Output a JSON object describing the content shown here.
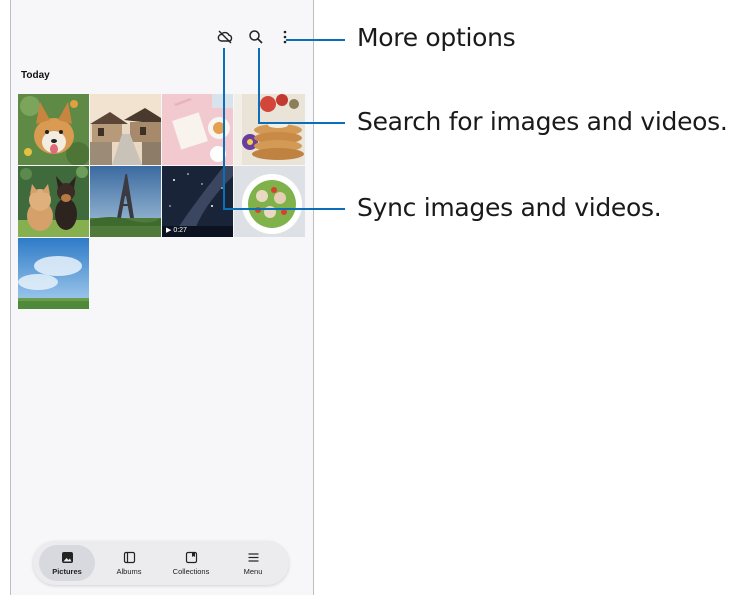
{
  "gallery": {
    "section_title": "Today",
    "video_duration": "▶ 0:27"
  },
  "toolbar": {
    "sync_icon": "cloud-off-icon",
    "search_icon": "search-icon",
    "more_icon": "more-vertical-icon"
  },
  "navbar": {
    "items": [
      {
        "label": "Pictures",
        "icon": "image-icon",
        "active": true
      },
      {
        "label": "Albums",
        "icon": "album-icon",
        "active": false
      },
      {
        "label": "Collections",
        "icon": "collections-icon",
        "active": false
      },
      {
        "label": "Menu",
        "icon": "menu-icon",
        "active": false
      }
    ]
  },
  "callouts": {
    "more_options": "More options",
    "search": "Search for images and videos.",
    "sync": "Sync images and videos."
  },
  "colors": {
    "callout_line": "#0b6fb8",
    "nav_active_bg": "#d8d9de"
  }
}
